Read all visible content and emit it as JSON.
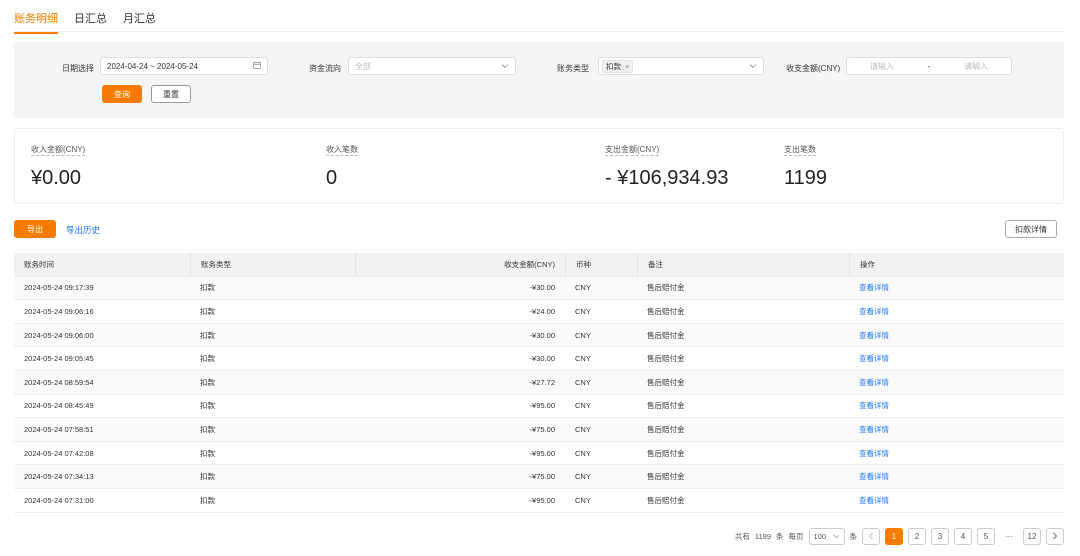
{
  "tabs": [
    {
      "label": "账务明细",
      "active": true
    },
    {
      "label": "日汇总",
      "active": false
    },
    {
      "label": "月汇总",
      "active": false
    }
  ],
  "filter": {
    "date_label": "日期选择",
    "date_value": "2024-04-24 ~ 2024-05-24",
    "flow_label": "资金流向",
    "flow_placeholder": "全部",
    "type_label": "账务类型",
    "type_tag": "扣款",
    "amount_label": "收支金额(CNY)",
    "amount_min_placeholder": "请输入",
    "amount_sep": "-",
    "amount_max_placeholder": "请输入",
    "query_button": "查询",
    "reset_button": "重置"
  },
  "summary": [
    {
      "label": "收入金额(CNY)",
      "value": "¥0.00"
    },
    {
      "label": "收入笔数",
      "value": "0"
    },
    {
      "label": "支出金额(CNY)",
      "value": "- ¥106,934.93"
    },
    {
      "label": "支出笔数",
      "value": "1199"
    }
  ],
  "actions": {
    "export_button": "导出",
    "export_history": "导出历史",
    "deduct_detail_button": "扣款详情"
  },
  "table": {
    "headers": [
      "账务时间",
      "账务类型",
      "收支金额(CNY)",
      "币种",
      "备注",
      "操作"
    ],
    "rows": [
      {
        "time": "2024-05-24 09:17:39",
        "type": "扣款",
        "amount": "-¥30.00",
        "currency": "CNY",
        "note": "售后赔付金",
        "action": "查看详情"
      },
      {
        "time": "2024-05-24 09:06:16",
        "type": "扣款",
        "amount": "-¥24.00",
        "currency": "CNY",
        "note": "售后赔付金",
        "action": "查看详情"
      },
      {
        "time": "2024-05-24 09:06:00",
        "type": "扣款",
        "amount": "-¥30.00",
        "currency": "CNY",
        "note": "售后赔付金",
        "action": "查看详情"
      },
      {
        "time": "2024-05-24 09:05:45",
        "type": "扣款",
        "amount": "-¥30.00",
        "currency": "CNY",
        "note": "售后赔付金",
        "action": "查看详情"
      },
      {
        "time": "2024-05-24 08:59:54",
        "type": "扣款",
        "amount": "-¥27.72",
        "currency": "CNY",
        "note": "售后赔付金",
        "action": "查看详情"
      },
      {
        "time": "2024-05-24 08:45:49",
        "type": "扣款",
        "amount": "-¥95.00",
        "currency": "CNY",
        "note": "售后赔付金",
        "action": "查看详情"
      },
      {
        "time": "2024-05-24 07:58:51",
        "type": "扣款",
        "amount": "-¥75.00",
        "currency": "CNY",
        "note": "售后赔付金",
        "action": "查看详情"
      },
      {
        "time": "2024-05-24 07:42:08",
        "type": "扣款",
        "amount": "-¥95.00",
        "currency": "CNY",
        "note": "售后赔付金",
        "action": "查看详情"
      },
      {
        "time": "2024-05-24 07:34:13",
        "type": "扣款",
        "amount": "-¥75.00",
        "currency": "CNY",
        "note": "售后赔付金",
        "action": "查看详情"
      },
      {
        "time": "2024-05-24 07:31:00",
        "type": "扣款",
        "amount": "-¥95.00",
        "currency": "CNY",
        "note": "售后赔付金",
        "action": "查看详情"
      }
    ]
  },
  "pagination": {
    "total_prefix": "共有",
    "total": "1199",
    "total_suffix": "条",
    "page_size_label": "每页",
    "page_size": "100",
    "page_size_suffix": "条",
    "pages": [
      "1",
      "2",
      "3",
      "4",
      "5"
    ],
    "ellipsis": "···",
    "last_page": "12",
    "current_page": "1"
  },
  "icons": {
    "calendar": "calendar-icon",
    "chevron_down": "chevron-down-icon",
    "tag_close": "close-icon",
    "prev": "chevron-left-icon",
    "next": "chevron-right-icon"
  },
  "colors": {
    "accent": "#f57c00",
    "link": "#1677ff"
  }
}
